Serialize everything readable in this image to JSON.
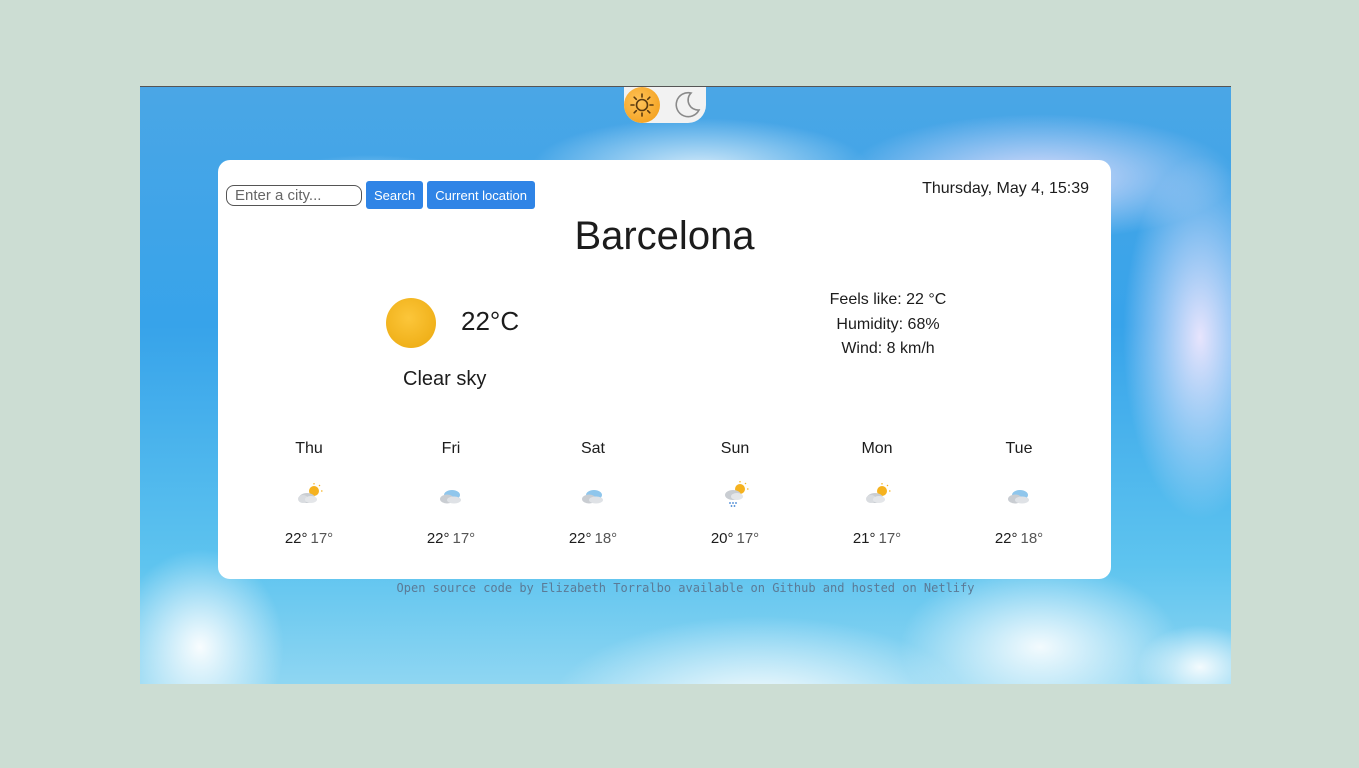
{
  "theme_toggle": {
    "light_icon": "sun-icon",
    "dark_icon": "moon-icon"
  },
  "search": {
    "placeholder": "Enter a city...",
    "value": "",
    "search_label": "Search",
    "current_location_label": "Current location"
  },
  "date": "Thursday, May 4, 15:39",
  "city": "Barcelona",
  "current": {
    "icon": "clear-sky-icon",
    "temperature": "22°C",
    "description": "Clear sky",
    "feels_like": "Feels like: 22 °C",
    "humidity": "Humidity: 68%",
    "wind": "Wind: 8 km/h"
  },
  "forecast": [
    {
      "day": "Thu",
      "icon": "partly-cloudy-icon",
      "max": "22°",
      "min": "17°"
    },
    {
      "day": "Fri",
      "icon": "cloudy-icon",
      "max": "22°",
      "min": "17°"
    },
    {
      "day": "Sat",
      "icon": "cloudy-icon",
      "max": "22°",
      "min": "18°"
    },
    {
      "day": "Sun",
      "icon": "sun-rain-icon",
      "max": "20°",
      "min": "17°"
    },
    {
      "day": "Mon",
      "icon": "partly-cloudy-icon",
      "max": "21°",
      "min": "17°"
    },
    {
      "day": "Tue",
      "icon": "cloudy-icon",
      "max": "22°",
      "min": "18°"
    }
  ],
  "footer": "Open source code by Elizabeth Torralbo available on Github and hosted on Netlify",
  "colors": {
    "accent": "#2f84e6",
    "background": "#ccddd3",
    "card": "#ffffff"
  }
}
